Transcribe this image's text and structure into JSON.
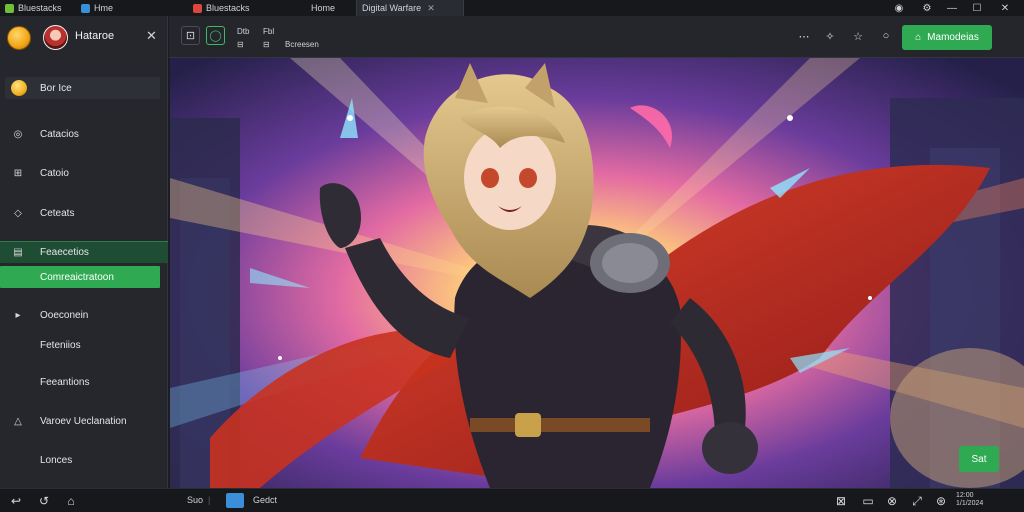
{
  "tabs": [
    {
      "label": "Bluestacks",
      "icon": "bluestacks-icon"
    },
    {
      "label": "Hme",
      "icon": "home-icon"
    },
    {
      "label": "Bluestacks",
      "icon": "app-icon"
    },
    {
      "label": "Home",
      "icon": "home-icon"
    },
    {
      "label": "Digital Warfare",
      "icon": "game-icon",
      "active": true
    }
  ],
  "sidebar": {
    "user_name": "Hataroe",
    "wallet_label": "Bor Ice",
    "items": [
      {
        "label": "Catacios",
        "icon": "gamepad-icon"
      },
      {
        "label": "Catoio",
        "icon": "apps-icon"
      },
      {
        "label": "Ceteats",
        "icon": "tag-icon"
      },
      {
        "label": "Feaecetios",
        "icon": "window-icon",
        "selected": true
      },
      {
        "label": "Comreaictratoon",
        "sub": true
      },
      {
        "label": "Ooeconein",
        "icon": "triangle-right-icon"
      },
      {
        "label": "Feteniios"
      },
      {
        "label": "Feeantions"
      },
      {
        "label": "Varoev Ueclanation",
        "icon": "warning-icon"
      },
      {
        "label": "Lonces"
      }
    ]
  },
  "toolbar": {
    "label_1": "Dtb",
    "label_2": "Fbl",
    "label_3": "Bcreesen",
    "primary_button": "Mamodeias"
  },
  "main": {
    "start_button": "Sat"
  },
  "bottombar": {
    "label_1": "Suo",
    "app_label": "Gedct",
    "time": "12:00",
    "date": "1/1/2024"
  }
}
